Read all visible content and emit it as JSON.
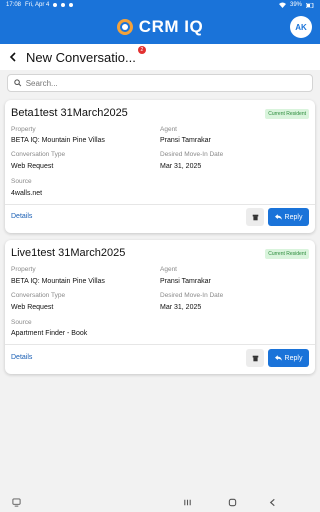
{
  "status_bar": {
    "time": "17:08",
    "date": "Fri, Apr 4",
    "battery": "39%"
  },
  "header": {
    "brand": "CRM IQ",
    "avatar_initials": "AK",
    "brand_color": "#1a73d9"
  },
  "title_bar": {
    "title": "New Conversatio...",
    "badge_count": "2"
  },
  "search": {
    "placeholder": "Search...",
    "value": ""
  },
  "labels": {
    "property": "Property",
    "agent": "Agent",
    "conversation_type": "Conversation Type",
    "desired_move_in": "Desired Move-In Date",
    "source": "Source",
    "details": "Details",
    "reply": "Reply"
  },
  "cards": [
    {
      "name": "Beta1test 31March2025",
      "status": "Current Resident",
      "property": "BETA IQ: Mountain Pine Villas",
      "agent": "Pransi Tamrakar",
      "conversation_type": "Web Request",
      "desired_move_in": "Mar 31, 2025",
      "source": "4walls.net"
    },
    {
      "name": "Live1test 31March2025",
      "status": "Current Resident",
      "property": "BETA IQ: Mountain Pine Villas",
      "agent": "Pransi Tamrakar",
      "conversation_type": "Web Request",
      "desired_move_in": "Mar 31, 2025",
      "source": "Apartment Finder - Book"
    }
  ]
}
